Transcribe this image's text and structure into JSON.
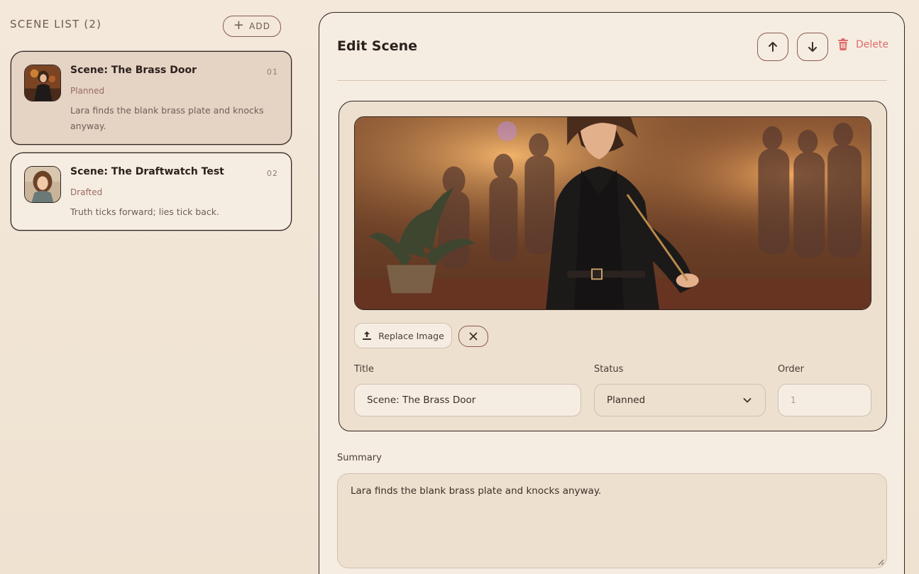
{
  "sidebar": {
    "title": "Scene List (2)",
    "add_label": "Add",
    "scenes": [
      {
        "name": "Scene: The Brass Door",
        "number": "01",
        "status": "Planned",
        "summary": "Lara finds the blank brass plate and knocks anyway."
      },
      {
        "name": "Scene: The Draftwatch Test",
        "number": "02",
        "status": "Drafted",
        "summary": "Truth ticks forward; lies tick back."
      }
    ]
  },
  "editor": {
    "title": "Edit Scene",
    "delete_label": "Delete",
    "replace_image_label": "Replace Image",
    "fields": {
      "title_label": "Title",
      "title_value": "Scene: The Brass Door",
      "status_label": "Status",
      "status_value": "Planned",
      "order_label": "Order",
      "order_value": "1"
    },
    "summary_label": "Summary",
    "summary_value": "Lara finds the blank brass plate and knocks anyway."
  },
  "icons": {
    "add": "plus-icon",
    "move_up": "arrow-up-icon",
    "move_down": "arrow-down-icon",
    "delete": "trash-icon",
    "replace": "upload-icon",
    "clear": "close-icon",
    "select": "chevron-down-icon"
  },
  "colors": {
    "background": "#f3e8da",
    "panel": "#f6ede2",
    "active_card": "#e5d3c4",
    "accent_border": "#8a5a52",
    "danger": "#dd6b6b"
  }
}
